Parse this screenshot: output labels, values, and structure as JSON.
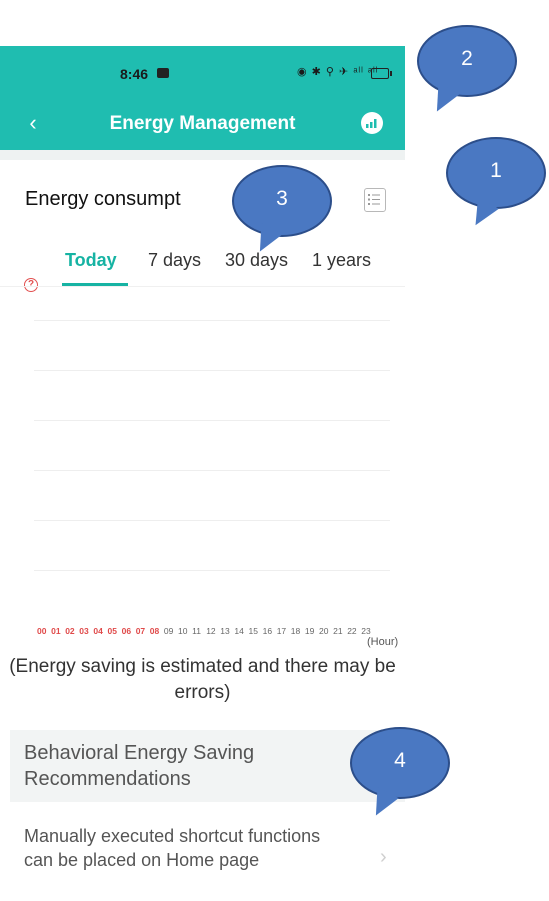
{
  "status_bar": {
    "time": "8:46",
    "icons": "◉ ✱ ⚲ ✈ ᵃˡˡ ᵃˡˡ"
  },
  "app_bar": {
    "title": "Energy Management",
    "back_glyph": "‹"
  },
  "section": {
    "title": "Energy consumpt"
  },
  "tabs": [
    {
      "label": "Today",
      "active": true
    },
    {
      "label": "7 days",
      "active": false
    },
    {
      "label": "30 days",
      "active": false
    },
    {
      "label": "1 years",
      "active": false
    }
  ],
  "help_glyph": "?",
  "chart_data": {
    "type": "bar",
    "categories": [
      "00",
      "01",
      "02",
      "03",
      "04",
      "05",
      "06",
      "07",
      "08",
      "09",
      "10",
      "11",
      "12",
      "13",
      "14",
      "15",
      "16",
      "17",
      "18",
      "19",
      "20",
      "21",
      "22",
      "23"
    ],
    "highlighted_categories": [
      "00",
      "01",
      "02",
      "03",
      "04",
      "05",
      "06",
      "07",
      "08"
    ],
    "values": [],
    "xlabel": "(Hour)",
    "grid": true,
    "colors": {
      "highlight": "#e04a4a",
      "normal": "#666666"
    }
  },
  "note": "(Energy saving is estimated and there may be errors)",
  "recommendations": {
    "header": "Behavioral Energy Saving Recommendations",
    "items": [
      {
        "text": "Manually executed shortcut functions can be placed on Home page",
        "chevron": "›"
      }
    ]
  },
  "callouts": [
    {
      "label": "2"
    },
    {
      "label": "1"
    },
    {
      "label": "3"
    },
    {
      "label": "4"
    }
  ],
  "colors": {
    "accent": "#1fbdb0",
    "tab_active": "#16b3a3",
    "callout": "#4a78c2"
  }
}
